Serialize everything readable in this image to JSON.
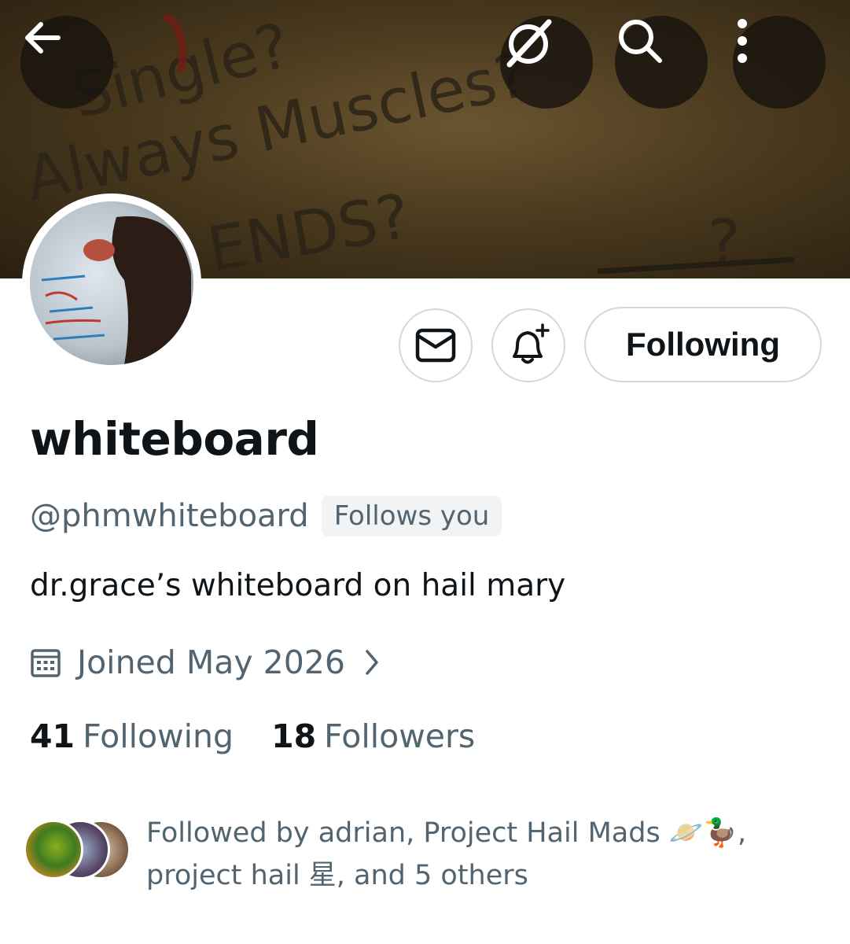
{
  "profile": {
    "display_name": "whiteboard",
    "handle": "@phmwhiteboard",
    "follows_you": "Follows you",
    "bio": "dr.grace’s whiteboard on hail mary",
    "joined": "Joined May 2026",
    "following_count": "41",
    "following_label": "Following",
    "followers_count": "18",
    "followers_label": "Followers",
    "followed_by_line1": "Followed by adrian, Project Hail Mads 🪐🦆,",
    "followed_by_line2": "project hail 星, and 5 others"
  },
  "actions": {
    "following_button": "Following"
  },
  "banner": {
    "scrawl": [
      "Single?",
      "Always Muscles?",
      "ENDS?",
      "?"
    ]
  },
  "icons": {
    "back": "back-arrow-icon",
    "grok": "grok-icon",
    "search": "search-icon",
    "more": "more-vertical-icon",
    "message": "message-icon",
    "notify": "bell-plus-icon",
    "calendar": "calendar-icon",
    "chevron": "chevron-right-icon"
  },
  "colors": {
    "text_primary": "#0f1419",
    "text_secondary": "#536471",
    "border": "#cfd9de"
  }
}
